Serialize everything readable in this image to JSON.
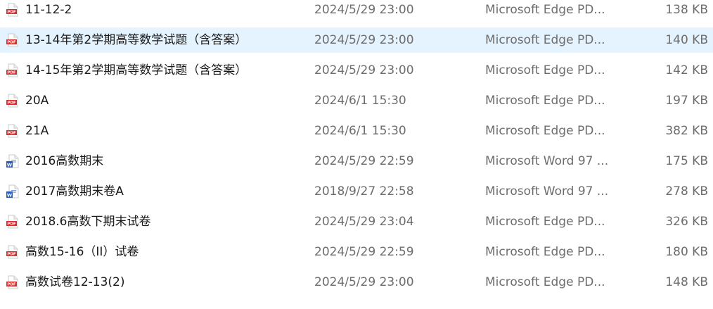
{
  "files": [
    {
      "name": "11-12-2",
      "modified": "2024/5/29 23:00",
      "type": "Microsoft Edge PD...",
      "size": "138 KB",
      "icon": "pdf-icon",
      "selected": false
    },
    {
      "name": "13-14年第2学期高等数学试题（含答案）",
      "modified": "2024/5/29 23:00",
      "type": "Microsoft Edge PD...",
      "size": "140 KB",
      "icon": "pdf-icon",
      "selected": true
    },
    {
      "name": "14-15年第2学期高等数学试题（含答案）",
      "modified": "2024/5/29 23:00",
      "type": "Microsoft Edge PD...",
      "size": "142 KB",
      "icon": "pdf-icon",
      "selected": false
    },
    {
      "name": "20A",
      "modified": "2024/6/1 15:30",
      "type": "Microsoft Edge PD...",
      "size": "197 KB",
      "icon": "pdf-icon",
      "selected": false
    },
    {
      "name": "21A",
      "modified": "2024/6/1 15:30",
      "type": "Microsoft Edge PD...",
      "size": "382 KB",
      "icon": "pdf-icon",
      "selected": false
    },
    {
      "name": "2016高数期末",
      "modified": "2024/5/29 22:59",
      "type": "Microsoft Word 97 ...",
      "size": "175 KB",
      "icon": "word-icon",
      "selected": false
    },
    {
      "name": "2017高数期末卷A",
      "modified": "2018/9/27 22:58",
      "type": "Microsoft Word 97 ...",
      "size": "278 KB",
      "icon": "word-icon",
      "selected": false
    },
    {
      "name": "2018.6高数下期末试卷",
      "modified": "2024/5/29 23:04",
      "type": "Microsoft Edge PD...",
      "size": "326 KB",
      "icon": "pdf-icon",
      "selected": false
    },
    {
      "name": "高数15-16（II）试卷",
      "modified": "2024/5/29 22:59",
      "type": "Microsoft Edge PD...",
      "size": "180 KB",
      "icon": "pdf-icon",
      "selected": false
    },
    {
      "name": "高数试卷12-13(2)",
      "modified": "2024/5/29 23:00",
      "type": "Microsoft Edge PD...",
      "size": "148 KB",
      "icon": "pdf-icon",
      "selected": false
    }
  ],
  "colors": {
    "selected_row": "#e5f3ff",
    "pdf_red": "#d32f2f",
    "word_blue": "#2b5fb8",
    "secondary_text": "#6d6d6d"
  }
}
